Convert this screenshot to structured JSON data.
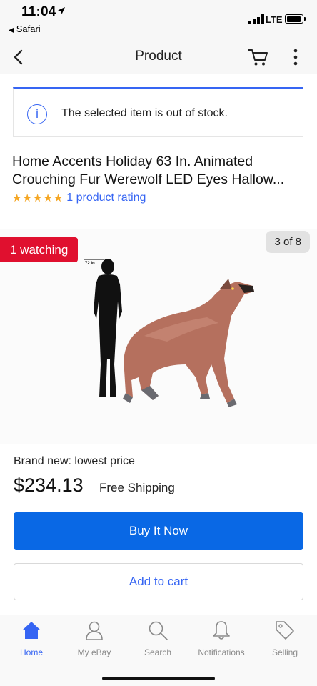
{
  "status_bar": {
    "time": "11:04",
    "back_app": "Safari",
    "network": "LTE"
  },
  "nav": {
    "title": "Product"
  },
  "alert": {
    "icon": "i",
    "message": "The selected item is out of stock."
  },
  "product": {
    "title": "Home Accents Holiday 63 In. Animated Crouching Fur Werewolf LED Eyes Hallow...",
    "stars": "★★★★★",
    "rating_text": "1 product rating",
    "watching_badge": "1 watching",
    "image_counter": "3 of 8",
    "image_label": "72 in",
    "condition": "Brand new: lowest price",
    "price": "$234.13",
    "shipping": "Free Shipping"
  },
  "actions": {
    "buy_now": "Buy It Now",
    "add_to_cart": "Add to cart"
  },
  "tabs": [
    {
      "label": "Home",
      "icon": "home-icon",
      "active": true
    },
    {
      "label": "My eBay",
      "icon": "person-icon",
      "active": false
    },
    {
      "label": "Search",
      "icon": "search-icon",
      "active": false
    },
    {
      "label": "Notifications",
      "icon": "bell-icon",
      "active": false
    },
    {
      "label": "Selling",
      "icon": "tag-icon",
      "active": false
    }
  ],
  "colors": {
    "accent": "#3665f3",
    "buy_button": "#0968e5",
    "watching_badge": "#e0102f",
    "stars": "#f5a623"
  }
}
